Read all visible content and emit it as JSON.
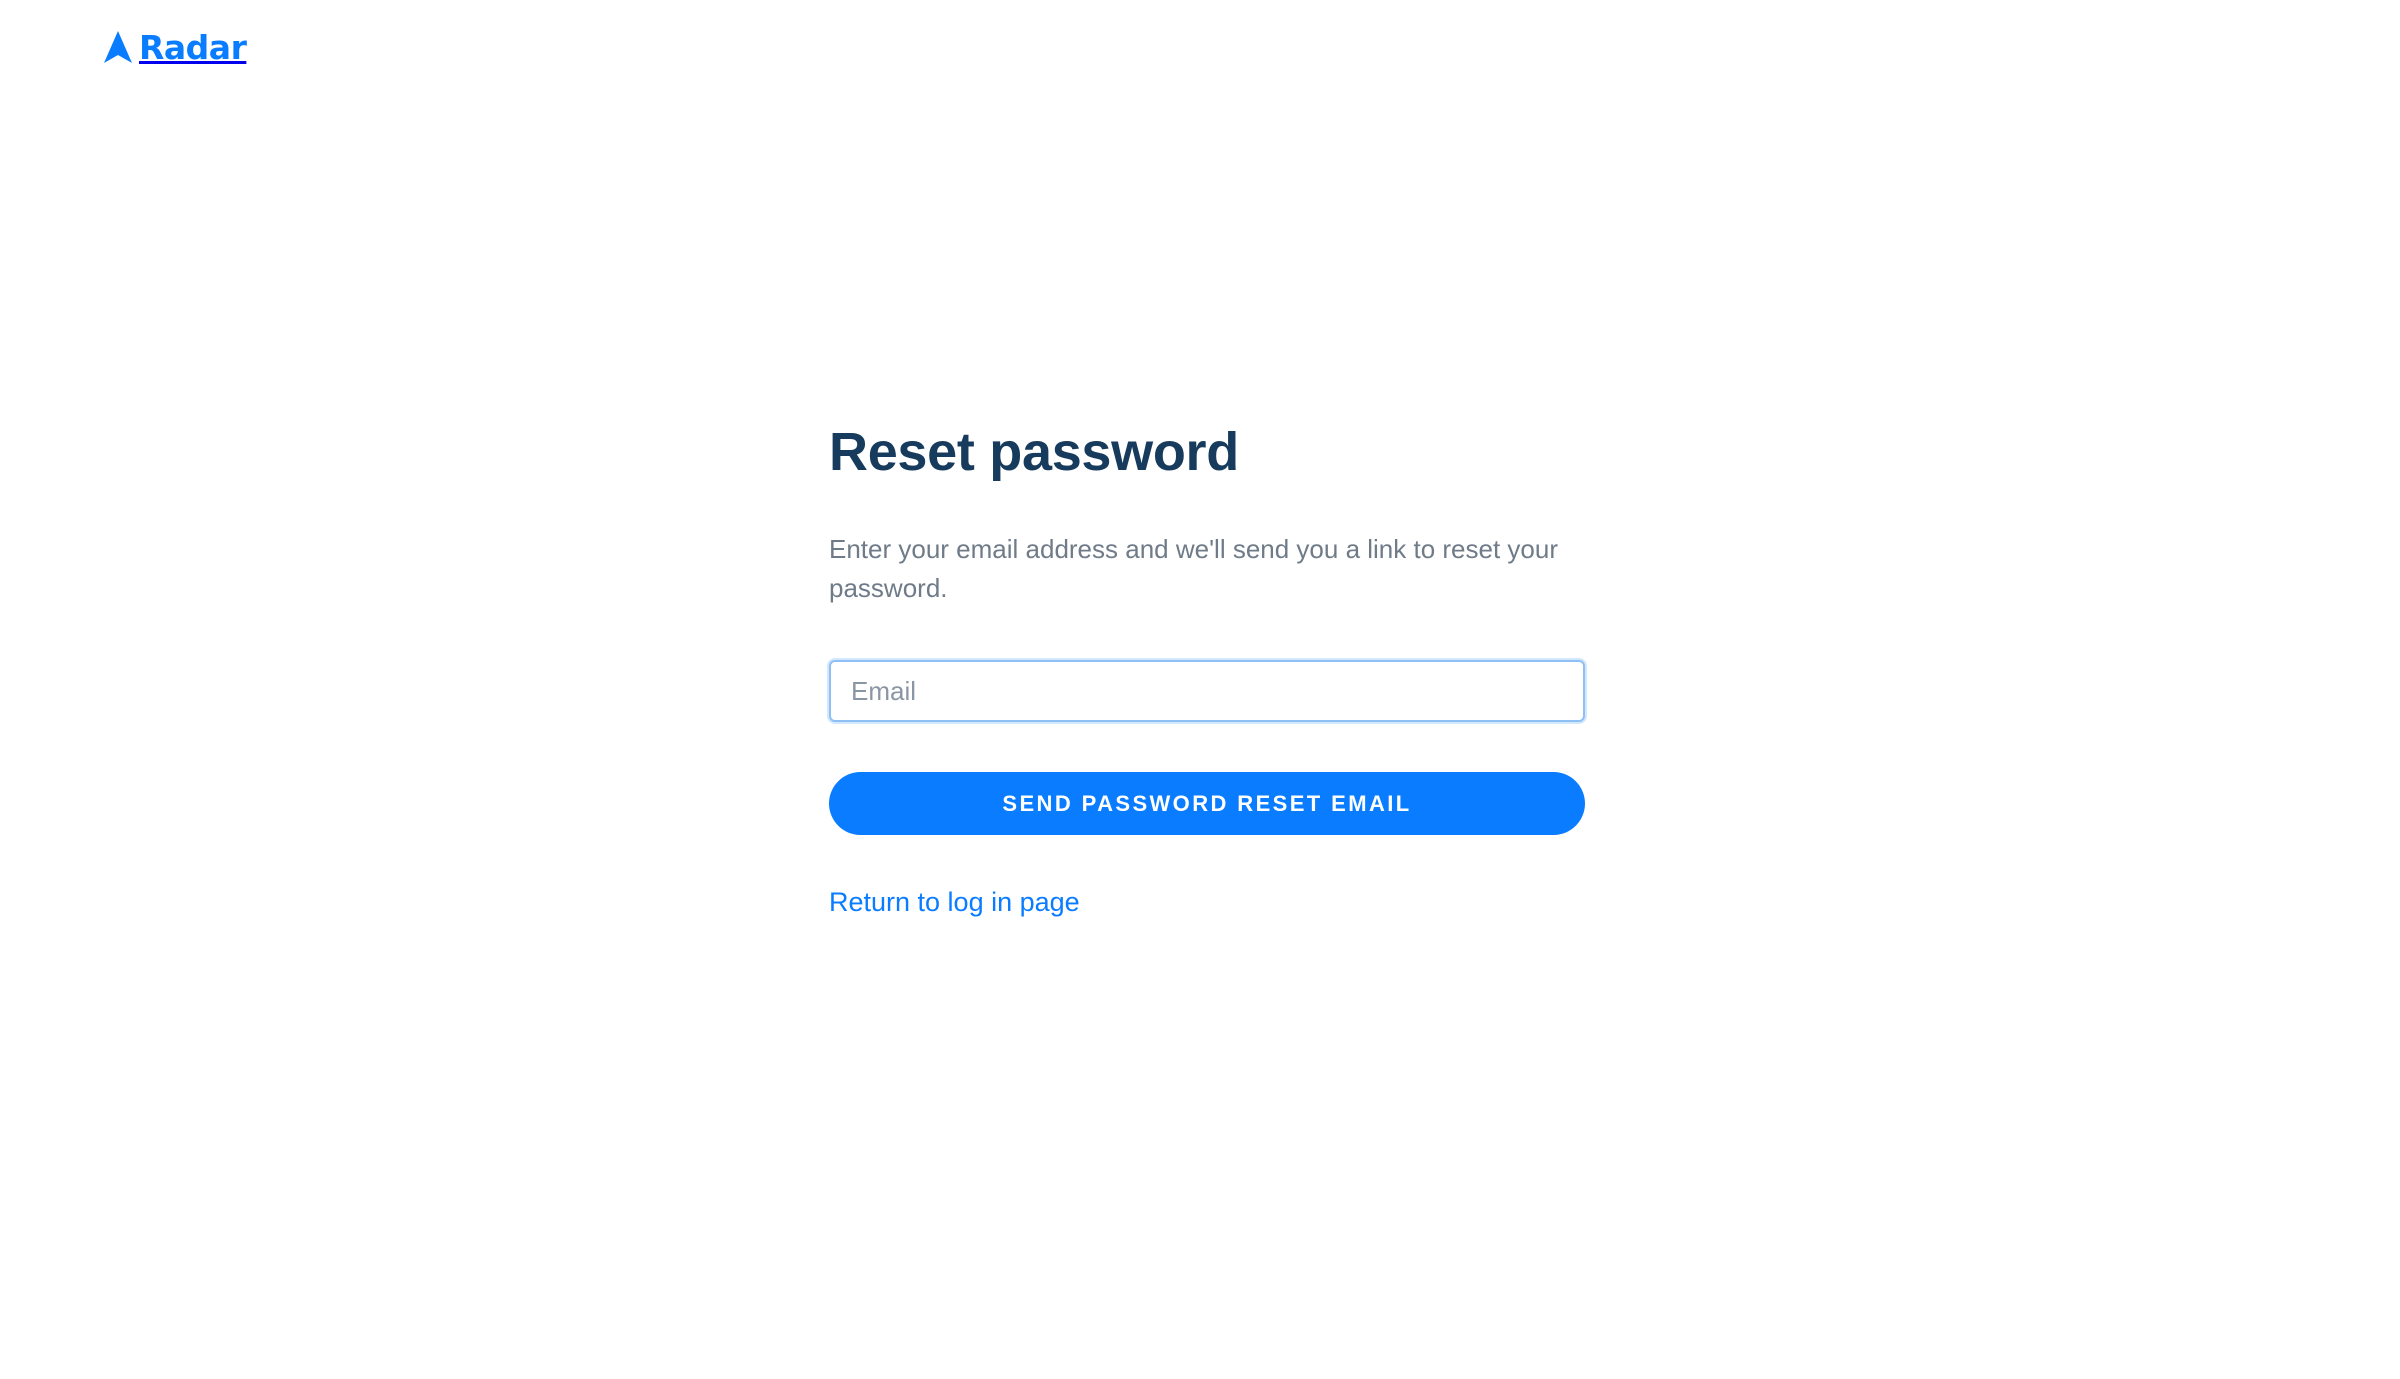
{
  "brand": {
    "name": "Radar",
    "color": "#0a7cff",
    "logo_icon": "radar-arrow-icon"
  },
  "reset_form": {
    "title": "Reset password",
    "description": "Enter your email address and we'll send you a link to reset your password.",
    "email_value": "",
    "email_placeholder": "Email",
    "submit_label": "SEND PASSWORD RESET EMAIL",
    "return_link_label": "Return to log in page"
  },
  "colors": {
    "title": "#173b5c",
    "body_text": "#6f7b88",
    "accent": "#0a7cff",
    "input_focus_border": "#8ec0f5"
  }
}
